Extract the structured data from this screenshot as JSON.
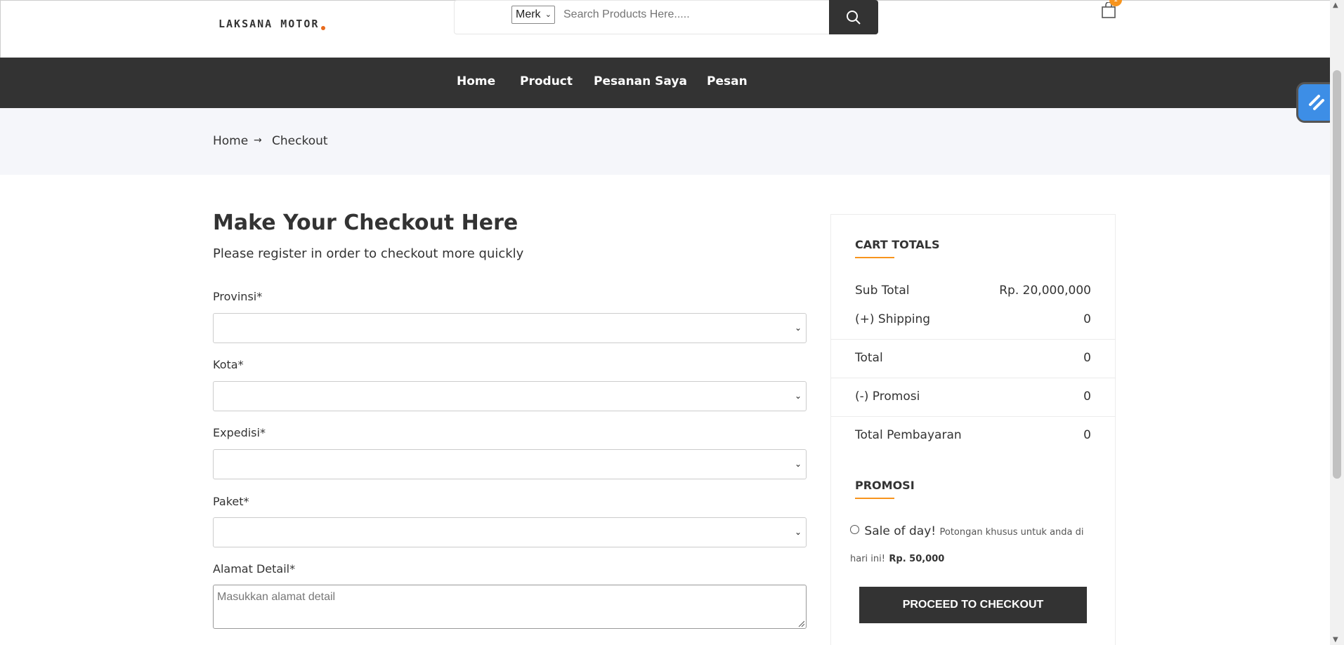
{
  "header": {
    "logo_text": "LAKSANA MOTOR",
    "brand_filter": "Merk",
    "search_placeholder": "Search Products Here.....",
    "cart_count": "1"
  },
  "nav": {
    "items": [
      "Home",
      "Product",
      "Pesanan Saya",
      "Pesan"
    ]
  },
  "breadcrumb": {
    "home": "Home",
    "current": "Checkout"
  },
  "form": {
    "title": "Make Your Checkout Here",
    "subtitle": "Please register in order to checkout more quickly",
    "provinsi_label": "Provinsi*",
    "kota_label": "Kota*",
    "expedisi_label": "Expedisi*",
    "paket_label": "Paket*",
    "alamat_label": "Alamat Detail*",
    "alamat_placeholder": "Masukkan alamat detail"
  },
  "totals": {
    "heading": "CART TOTALS",
    "subtotal_label": "Sub Total",
    "subtotal_value": "Rp. 20,000,000",
    "shipping_label": "(+) Shipping",
    "shipping_value": "0",
    "total_label": "Total",
    "total_value": "0",
    "promosi_label": "(-) Promosi",
    "promosi_value": "0",
    "pembayaran_label": "Total Pembayaran",
    "pembayaran_value": "0",
    "promo_heading": "PROMOSI",
    "promo_name": "Sale of day!",
    "promo_desc": "Potongan khusus untuk anda di hari ini!",
    "promo_amount": "Rp. 50,000",
    "checkout_button": "PROCEED TO CHECKOUT"
  },
  "colors": {
    "accent": "#f7941d",
    "dark": "#333333",
    "crumb_bg": "#f5f6fa"
  }
}
